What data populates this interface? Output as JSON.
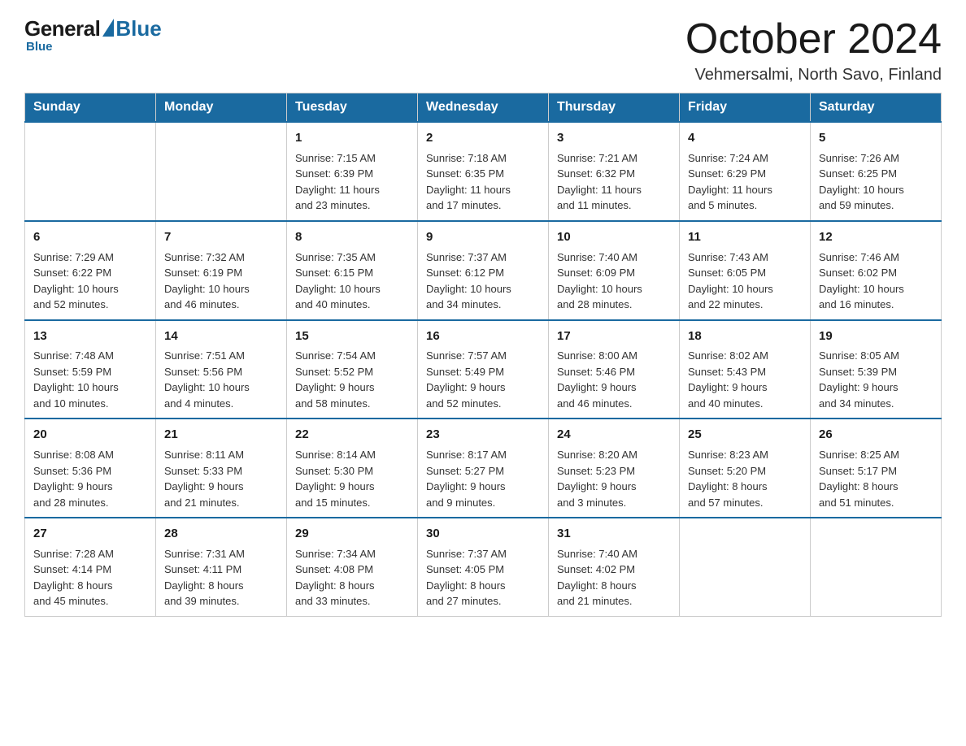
{
  "logo": {
    "general": "General",
    "blue": "Blue",
    "triangle": "▲"
  },
  "header": {
    "month": "October 2024",
    "location": "Vehmersalmi, North Savo, Finland"
  },
  "weekdays": [
    "Sunday",
    "Monday",
    "Tuesday",
    "Wednesday",
    "Thursday",
    "Friday",
    "Saturday"
  ],
  "weeks": [
    [
      {
        "day": "",
        "info": ""
      },
      {
        "day": "",
        "info": ""
      },
      {
        "day": "1",
        "info": "Sunrise: 7:15 AM\nSunset: 6:39 PM\nDaylight: 11 hours\nand 23 minutes."
      },
      {
        "day": "2",
        "info": "Sunrise: 7:18 AM\nSunset: 6:35 PM\nDaylight: 11 hours\nand 17 minutes."
      },
      {
        "day": "3",
        "info": "Sunrise: 7:21 AM\nSunset: 6:32 PM\nDaylight: 11 hours\nand 11 minutes."
      },
      {
        "day": "4",
        "info": "Sunrise: 7:24 AM\nSunset: 6:29 PM\nDaylight: 11 hours\nand 5 minutes."
      },
      {
        "day": "5",
        "info": "Sunrise: 7:26 AM\nSunset: 6:25 PM\nDaylight: 10 hours\nand 59 minutes."
      }
    ],
    [
      {
        "day": "6",
        "info": "Sunrise: 7:29 AM\nSunset: 6:22 PM\nDaylight: 10 hours\nand 52 minutes."
      },
      {
        "day": "7",
        "info": "Sunrise: 7:32 AM\nSunset: 6:19 PM\nDaylight: 10 hours\nand 46 minutes."
      },
      {
        "day": "8",
        "info": "Sunrise: 7:35 AM\nSunset: 6:15 PM\nDaylight: 10 hours\nand 40 minutes."
      },
      {
        "day": "9",
        "info": "Sunrise: 7:37 AM\nSunset: 6:12 PM\nDaylight: 10 hours\nand 34 minutes."
      },
      {
        "day": "10",
        "info": "Sunrise: 7:40 AM\nSunset: 6:09 PM\nDaylight: 10 hours\nand 28 minutes."
      },
      {
        "day": "11",
        "info": "Sunrise: 7:43 AM\nSunset: 6:05 PM\nDaylight: 10 hours\nand 22 minutes."
      },
      {
        "day": "12",
        "info": "Sunrise: 7:46 AM\nSunset: 6:02 PM\nDaylight: 10 hours\nand 16 minutes."
      }
    ],
    [
      {
        "day": "13",
        "info": "Sunrise: 7:48 AM\nSunset: 5:59 PM\nDaylight: 10 hours\nand 10 minutes."
      },
      {
        "day": "14",
        "info": "Sunrise: 7:51 AM\nSunset: 5:56 PM\nDaylight: 10 hours\nand 4 minutes."
      },
      {
        "day": "15",
        "info": "Sunrise: 7:54 AM\nSunset: 5:52 PM\nDaylight: 9 hours\nand 58 minutes."
      },
      {
        "day": "16",
        "info": "Sunrise: 7:57 AM\nSunset: 5:49 PM\nDaylight: 9 hours\nand 52 minutes."
      },
      {
        "day": "17",
        "info": "Sunrise: 8:00 AM\nSunset: 5:46 PM\nDaylight: 9 hours\nand 46 minutes."
      },
      {
        "day": "18",
        "info": "Sunrise: 8:02 AM\nSunset: 5:43 PM\nDaylight: 9 hours\nand 40 minutes."
      },
      {
        "day": "19",
        "info": "Sunrise: 8:05 AM\nSunset: 5:39 PM\nDaylight: 9 hours\nand 34 minutes."
      }
    ],
    [
      {
        "day": "20",
        "info": "Sunrise: 8:08 AM\nSunset: 5:36 PM\nDaylight: 9 hours\nand 28 minutes."
      },
      {
        "day": "21",
        "info": "Sunrise: 8:11 AM\nSunset: 5:33 PM\nDaylight: 9 hours\nand 21 minutes."
      },
      {
        "day": "22",
        "info": "Sunrise: 8:14 AM\nSunset: 5:30 PM\nDaylight: 9 hours\nand 15 minutes."
      },
      {
        "day": "23",
        "info": "Sunrise: 8:17 AM\nSunset: 5:27 PM\nDaylight: 9 hours\nand 9 minutes."
      },
      {
        "day": "24",
        "info": "Sunrise: 8:20 AM\nSunset: 5:23 PM\nDaylight: 9 hours\nand 3 minutes."
      },
      {
        "day": "25",
        "info": "Sunrise: 8:23 AM\nSunset: 5:20 PM\nDaylight: 8 hours\nand 57 minutes."
      },
      {
        "day": "26",
        "info": "Sunrise: 8:25 AM\nSunset: 5:17 PM\nDaylight: 8 hours\nand 51 minutes."
      }
    ],
    [
      {
        "day": "27",
        "info": "Sunrise: 7:28 AM\nSunset: 4:14 PM\nDaylight: 8 hours\nand 45 minutes."
      },
      {
        "day": "28",
        "info": "Sunrise: 7:31 AM\nSunset: 4:11 PM\nDaylight: 8 hours\nand 39 minutes."
      },
      {
        "day": "29",
        "info": "Sunrise: 7:34 AM\nSunset: 4:08 PM\nDaylight: 8 hours\nand 33 minutes."
      },
      {
        "day": "30",
        "info": "Sunrise: 7:37 AM\nSunset: 4:05 PM\nDaylight: 8 hours\nand 27 minutes."
      },
      {
        "day": "31",
        "info": "Sunrise: 7:40 AM\nSunset: 4:02 PM\nDaylight: 8 hours\nand 21 minutes."
      },
      {
        "day": "",
        "info": ""
      },
      {
        "day": "",
        "info": ""
      }
    ]
  ]
}
